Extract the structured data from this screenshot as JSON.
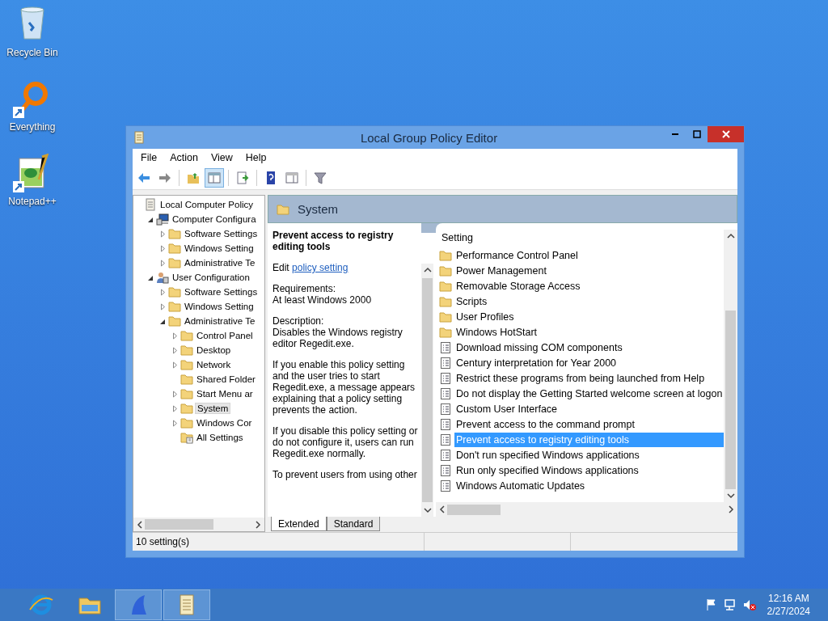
{
  "desktop_icons": [
    {
      "label": "Recycle Bin",
      "kind": "recycle",
      "shortcut": false
    },
    {
      "label": "Everything",
      "kind": "search",
      "shortcut": true
    },
    {
      "label": "Notepad++",
      "kind": "notepad",
      "shortcut": true
    }
  ],
  "window": {
    "title": "Local Group Policy Editor",
    "menu": [
      "File",
      "Action",
      "View",
      "Help"
    ],
    "tree": [
      {
        "label": "Local Computer Policy",
        "kind": "root",
        "selected": false,
        "children": [
          {
            "label": "Computer Configura",
            "kind": "computer",
            "expanded": true,
            "selected": false,
            "children": [
              {
                "label": "Software Settings",
                "kind": "folder",
                "expanded": false,
                "selected": false
              },
              {
                "label": "Windows Setting",
                "kind": "folder",
                "expanded": false,
                "selected": false
              },
              {
                "label": "Administrative Te",
                "kind": "folder",
                "expanded": false,
                "selected": false
              }
            ]
          },
          {
            "label": "User Configuration",
            "kind": "user",
            "expanded": true,
            "selected": false,
            "children": [
              {
                "label": "Software Settings",
                "kind": "folder",
                "expanded": false,
                "selected": false
              },
              {
                "label": "Windows Setting",
                "kind": "folder",
                "expanded": false,
                "selected": false
              },
              {
                "label": "Administrative Te",
                "kind": "folder",
                "expanded": true,
                "selected": false,
                "children": [
                  {
                    "label": "Control Panel",
                    "kind": "folder",
                    "expanded": false,
                    "selected": false
                  },
                  {
                    "label": "Desktop",
                    "kind": "folder",
                    "expanded": false,
                    "selected": false
                  },
                  {
                    "label": "Network",
                    "kind": "folder",
                    "expanded": false,
                    "selected": false
                  },
                  {
                    "label": "Shared Folder",
                    "kind": "folder",
                    "selected": false
                  },
                  {
                    "label": "Start Menu ar",
                    "kind": "folder",
                    "expanded": false,
                    "selected": false
                  },
                  {
                    "label": "System",
                    "kind": "folder",
                    "expanded": false,
                    "selected": true
                  },
                  {
                    "label": "Windows Cor",
                    "kind": "folder",
                    "expanded": false,
                    "selected": false
                  },
                  {
                    "label": "All Settings",
                    "kind": "all",
                    "selected": false
                  }
                ]
              }
            ]
          }
        ]
      }
    ],
    "header": "System",
    "description": {
      "title": "Prevent access to registry editing tools",
      "edit_prefix": "Edit",
      "edit_link": "policy setting",
      "paragraphs": [
        "Requirements:\nAt least Windows 2000",
        "Description:\nDisables the Windows registry editor Regedit.exe.",
        "If you enable this policy setting and the user tries to start Regedit.exe, a message appears explaining that a policy setting prevents the action.",
        "If you disable this policy setting or do not configure it, users can run Regedit.exe normally.",
        "To prevent users from using other"
      ]
    },
    "list": {
      "column": "Setting",
      "rows": [
        {
          "label": "Performance Control Panel",
          "kind": "folder",
          "selected": false
        },
        {
          "label": "Power Management",
          "kind": "folder",
          "selected": false
        },
        {
          "label": "Removable Storage Access",
          "kind": "folder",
          "selected": false
        },
        {
          "label": "Scripts",
          "kind": "folder",
          "selected": false
        },
        {
          "label": "User Profiles",
          "kind": "folder",
          "selected": false
        },
        {
          "label": "Windows HotStart",
          "kind": "folder",
          "selected": false
        },
        {
          "label": "Download missing COM components",
          "kind": "policy",
          "selected": false
        },
        {
          "label": "Century interpretation for Year 2000",
          "kind": "policy",
          "selected": false
        },
        {
          "label": "Restrict these programs from being launched from Help",
          "kind": "policy",
          "selected": false
        },
        {
          "label": "Do not display the Getting Started welcome screen at logon",
          "kind": "policy",
          "selected": false
        },
        {
          "label": "Custom User Interface",
          "kind": "policy",
          "selected": false
        },
        {
          "label": "Prevent access to the command prompt",
          "kind": "policy",
          "selected": false
        },
        {
          "label": "Prevent access to registry editing tools",
          "kind": "policy",
          "selected": true
        },
        {
          "label": "Don't run specified Windows applications",
          "kind": "policy",
          "selected": false
        },
        {
          "label": "Run only specified Windows applications",
          "kind": "policy",
          "selected": false
        },
        {
          "label": "Windows Automatic Updates",
          "kind": "policy",
          "selected": false
        }
      ]
    },
    "view_tabs": [
      {
        "label": "Extended",
        "selected": true
      },
      {
        "label": "Standard",
        "selected": false
      }
    ],
    "status": "10 setting(s)"
  },
  "taskbar": {
    "apps": [
      {
        "kind": "browser",
        "running": false
      },
      {
        "kind": "files",
        "running": false
      },
      {
        "kind": "shark",
        "running": true
      },
      {
        "kind": "scroll",
        "running": true
      }
    ],
    "time": "12:16 AM",
    "date": "2/27/2024"
  }
}
